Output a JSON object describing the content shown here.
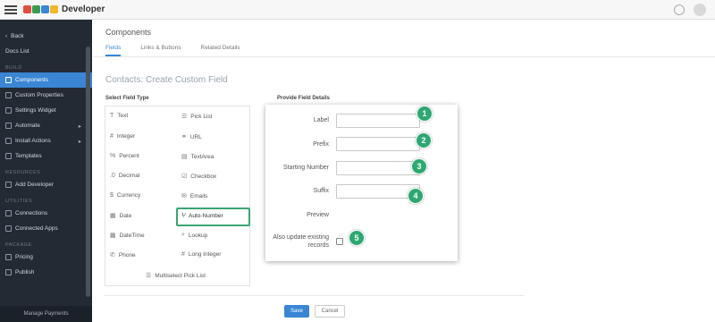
{
  "app": {
    "brand": "Developer",
    "logo_colors": [
      "#e34d3e",
      "#3a9b4f",
      "#3a86d4",
      "#f2b62a"
    ]
  },
  "sidebar": {
    "back": "Back",
    "module": "Docs List",
    "section_build": "BUILD",
    "items": [
      {
        "label": "Components",
        "active": true
      },
      {
        "label": "Custom Properties"
      },
      {
        "label": "Settings Widget"
      },
      {
        "label": "Automate",
        "arrow": "▸"
      },
      {
        "label": "Install Actions",
        "arrow": "▸"
      },
      {
        "label": "Templates"
      }
    ],
    "section_resources": "RESOURCES",
    "resources_items": [
      {
        "label": "Add Developer"
      }
    ],
    "section_utilities": "UTILITIES",
    "utilities_items": [
      {
        "label": "Connections"
      },
      {
        "label": "Connected Apps"
      }
    ],
    "section_package": "PACKAGE",
    "package_items": [
      {
        "label": "Pricing"
      },
      {
        "label": "Publish"
      }
    ],
    "footer": "Manage Payments"
  },
  "header": {
    "title": "Components",
    "tabs": [
      "Fields",
      "Links & Buttons",
      "Related Details"
    ]
  },
  "page": {
    "title": "Contacts: Create Custom Field"
  },
  "field_types": {
    "title": "Select Field Type",
    "left": [
      "Text",
      "Integer",
      "Percent",
      "Decimal",
      "Currency",
      "Date",
      "DateTime",
      "Phone"
    ],
    "right": [
      "Pick List",
      "URL",
      "TextArea",
      "Checkbox",
      "Emails",
      "Auto-Number",
      "Lookup",
      "Long Integer"
    ],
    "bottom": "Multiselect Pick List",
    "selected": "Auto-Number"
  },
  "details": {
    "title": "Provide Field Details",
    "label": "Label",
    "prefix": "Prefix",
    "starting_number": "Starting Number",
    "suffix": "Suffix",
    "preview": "Preview",
    "update_existing": "Also update existing records",
    "update_line1": "Also update existing",
    "update_line2": "records",
    "badges": [
      "1",
      "2",
      "3",
      "4",
      "5"
    ]
  },
  "actions": {
    "save": "Save",
    "cancel": "Cancel"
  }
}
